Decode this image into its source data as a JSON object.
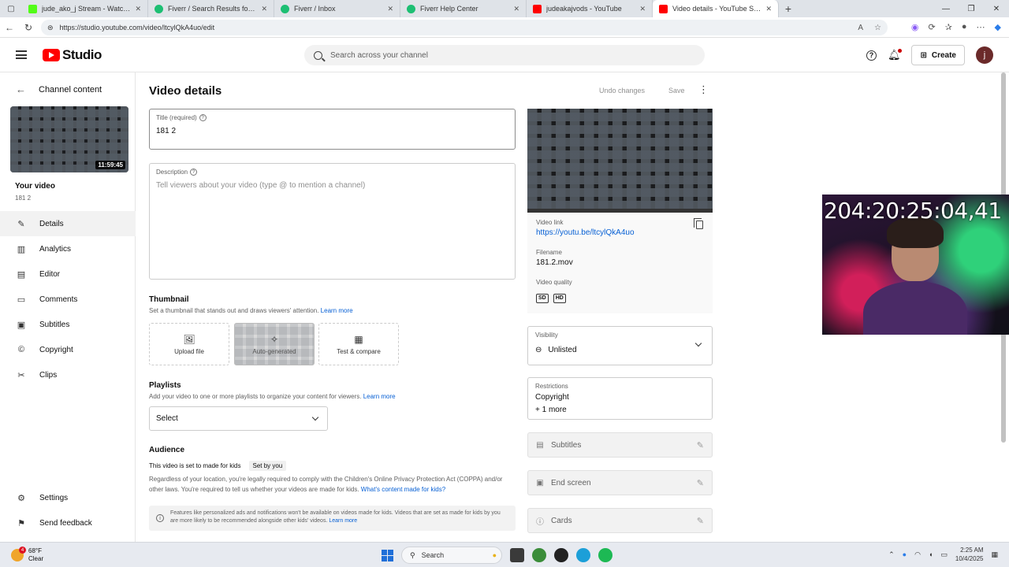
{
  "browser": {
    "tabs": [
      {
        "label": "jude_ako_j Stream - Watch Live on...",
        "color": "#53fc18"
      },
      {
        "label": "Fiverr / Search Results for 'youtub...",
        "color": "#1dbf73"
      },
      {
        "label": "Fiverr / Inbox",
        "color": "#1dbf73"
      },
      {
        "label": "Fiverr Help Center",
        "color": "#1dbf73"
      },
      {
        "label": "judeakajvods - YouTube",
        "color": "#ff0000"
      },
      {
        "label": "Video details - YouTube Studio",
        "color": "#ff0000"
      }
    ],
    "url": "https://studio.youtube.com/video/ltcylQkA4uo/edit"
  },
  "header": {
    "logo_text": "Studio",
    "search_placeholder": "Search across your channel",
    "create_label": "Create",
    "avatar_letter": "j"
  },
  "sidebar": {
    "back_label": "Channel content",
    "thumb_duration": "11:59:45",
    "your_video": "Your video",
    "video_title": "181 2",
    "items": [
      {
        "label": "Details",
        "icon": "pencil-icon"
      },
      {
        "label": "Analytics",
        "icon": "analytics-icon"
      },
      {
        "label": "Editor",
        "icon": "editor-icon"
      },
      {
        "label": "Comments",
        "icon": "comments-icon"
      },
      {
        "label": "Subtitles",
        "icon": "subtitles-icon"
      },
      {
        "label": "Copyright",
        "icon": "copyright-icon"
      },
      {
        "label": "Clips",
        "icon": "clips-icon"
      }
    ],
    "bottom_items": [
      {
        "label": "Settings",
        "icon": "gear-icon"
      },
      {
        "label": "Send feedback",
        "icon": "feedback-icon"
      }
    ]
  },
  "main": {
    "page_title": "Video details",
    "undo_label": "Undo changes",
    "save_label": "Save",
    "title_field": {
      "label": "Title (required)",
      "value": "181 2"
    },
    "description_field": {
      "label": "Description",
      "placeholder": "Tell viewers about your video (type @ to mention a channel)"
    },
    "thumbnail": {
      "title": "Thumbnail",
      "subtitle": "Set a thumbnail that stands out and draws viewers' attention.",
      "learn_more": "Learn more",
      "options": [
        "Upload file",
        "Auto-generated",
        "Test & compare"
      ]
    },
    "playlists": {
      "title": "Playlists",
      "subtitle": "Add your video to one or more playlists to organize your content for viewers.",
      "learn_more": "Learn more",
      "select_label": "Select"
    },
    "audience": {
      "title": "Audience",
      "status": "This video is set to made for kids",
      "badge": "Set by you",
      "text": "Regardless of your location, you're legally required to comply with the Children's Online Privacy Protection Act (COPPA) and/or other laws. You're required to tell us whether your videos are made for kids.",
      "link": "What's content made for kids?",
      "info_text": "Features like personalized ads and notifications won't be available on videos made for kids. Videos that are set as made for kids by you are more likely to be recommended alongside other kids' videos.",
      "info_link": "Learn more"
    }
  },
  "right": {
    "video_link_label": "Video link",
    "video_link": "https://youtu.be/ltcylQkA4uo",
    "filename_label": "Filename",
    "filename": "181.2.mov",
    "quality_label": "Video quality",
    "quality_badges": [
      "SD",
      "HD"
    ],
    "visibility_label": "Visibility",
    "visibility_value": "Unlisted",
    "restrictions_label": "Restrictions",
    "restriction_1": "Copyright",
    "restriction_2": "+ 1 more",
    "features": [
      "Subtitles",
      "End screen",
      "Cards"
    ]
  },
  "overlay": {
    "timer": "204:20:25:04,41"
  },
  "taskbar": {
    "temp": "68°F",
    "weather": "Clear",
    "search_label": "Search",
    "time": "2:25 AM",
    "date": "10/4/2025"
  }
}
